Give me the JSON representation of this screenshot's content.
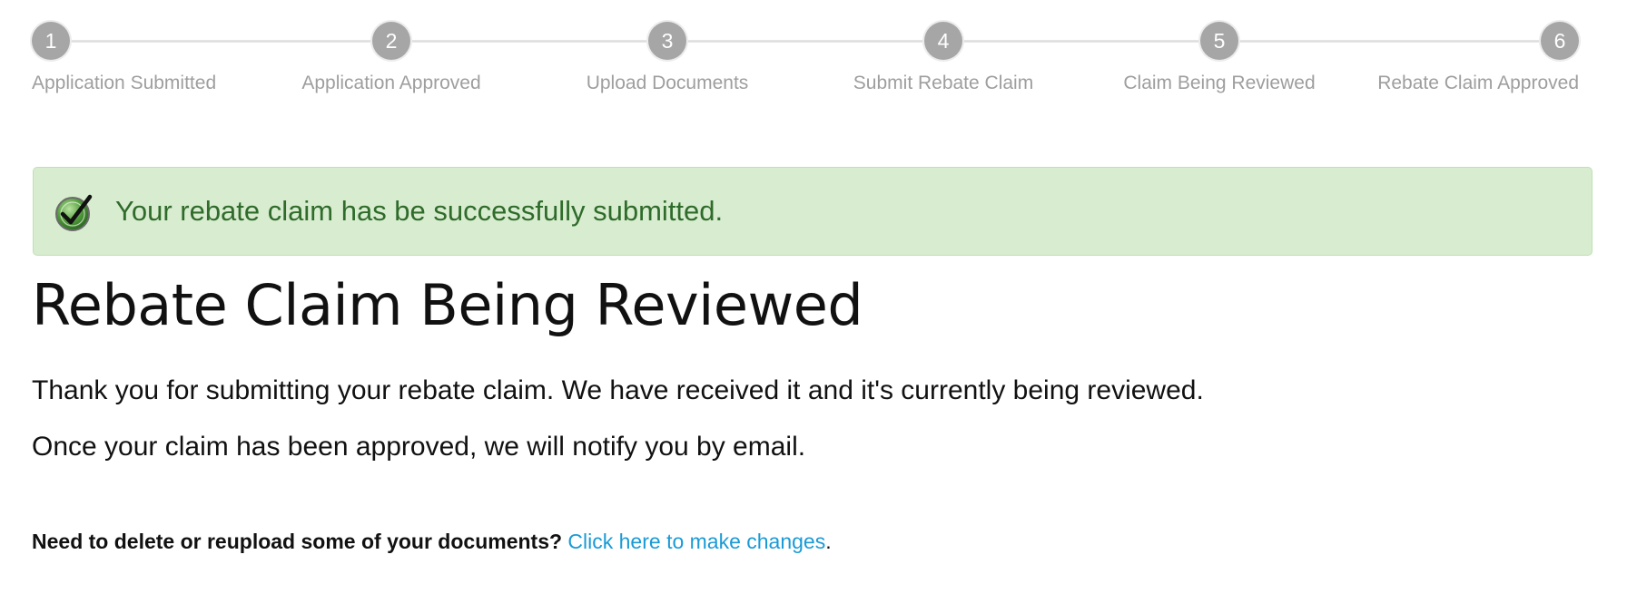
{
  "steps": [
    {
      "number": "1",
      "label": "Application Submitted"
    },
    {
      "number": "2",
      "label": "Application Approved"
    },
    {
      "number": "3",
      "label": "Upload Documents"
    },
    {
      "number": "4",
      "label": "Submit Rebate Claim"
    },
    {
      "number": "5",
      "label": "Claim Being Reviewed"
    },
    {
      "number": "6",
      "label": "Rebate Claim Approved"
    }
  ],
  "alert": {
    "icon": "checkmark-icon",
    "message": "Your rebate claim has be successfully submitted."
  },
  "page": {
    "title": "Rebate Claim Being Reviewed",
    "paragraph1": "Thank you for submitting your rebate claim. We have received it and it's currently being reviewed.",
    "paragraph2": "Once your claim has been approved, we will notify you by email."
  },
  "help": {
    "question": "Need to delete or reupload some of your documents?",
    "link_text": "Click here to make changes",
    "suffix": "."
  },
  "colors": {
    "step_circle": "#a6a6a6",
    "step_label": "#9e9e9e",
    "alert_bg": "#d8ecd0",
    "alert_text": "#2f6b2a",
    "link": "#1a9ad6"
  }
}
